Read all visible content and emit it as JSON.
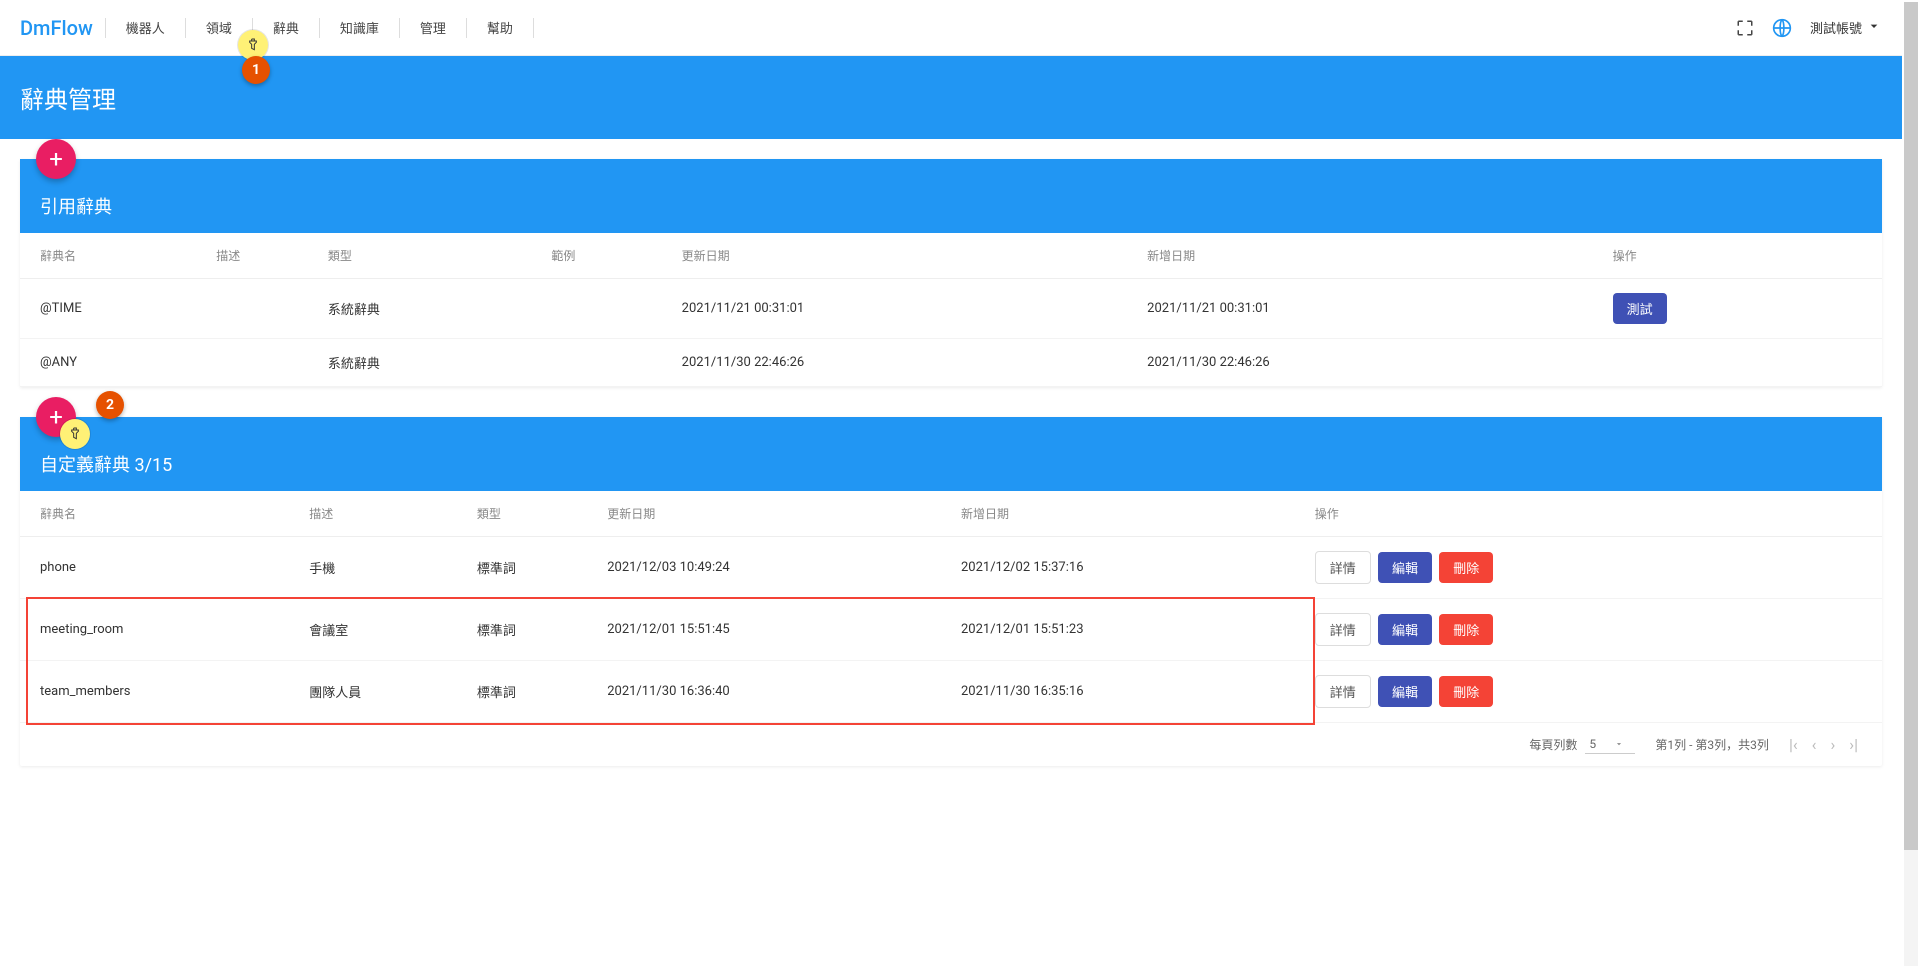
{
  "brand": "DmFlow",
  "nav": [
    "機器人",
    "領域",
    "辭典",
    "知識庫",
    "管理",
    "幫助"
  ],
  "account_label": "測試帳號",
  "page_title": "辭典管理",
  "fab_label": "+",
  "card1": {
    "title": "引用辭典",
    "cols": [
      "辭典名",
      "描述",
      "類型",
      "範例",
      "更新日期",
      "新增日期",
      "操作"
    ],
    "rows": [
      {
        "name": "@TIME",
        "desc": "",
        "type": "系統辭典",
        "example": "",
        "updated": "2021/11/21 00:31:01",
        "created": "2021/11/21 00:31:01",
        "action": "測試"
      },
      {
        "name": "@ANY",
        "desc": "",
        "type": "系統辭典",
        "example": "",
        "updated": "2021/11/30 22:46:26",
        "created": "2021/11/30 22:46:26",
        "action": ""
      }
    ]
  },
  "card2": {
    "title": "自定義辭典 3/15",
    "cols": [
      "辭典名",
      "描述",
      "類型",
      "更新日期",
      "新增日期",
      "操作"
    ],
    "rows": [
      {
        "name": "phone",
        "desc": "手機",
        "type": "標準詞",
        "updated": "2021/12/03 10:49:24",
        "created": "2021/12/02 15:37:16"
      },
      {
        "name": "meeting_room",
        "desc": "會議室",
        "type": "標準詞",
        "updated": "2021/12/01 15:51:45",
        "created": "2021/12/01 15:51:23"
      },
      {
        "name": "team_members",
        "desc": "團隊人員",
        "type": "標準詞",
        "updated": "2021/11/30 16:36:40",
        "created": "2021/11/30 16:35:16"
      }
    ],
    "actions": {
      "detail": "詳情",
      "edit": "編輯",
      "delete": "刪除"
    },
    "pagination": {
      "per_page_label": "每頁列數",
      "per_page_value": "5",
      "range": "第1列 - 第3列，共3列"
    }
  },
  "callouts": {
    "c1": "1",
    "c2": "2"
  }
}
